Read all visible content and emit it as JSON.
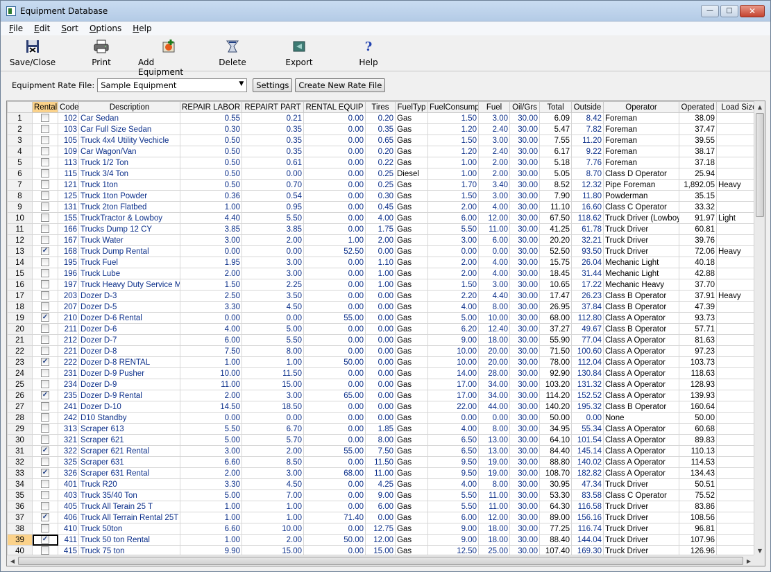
{
  "window": {
    "title": "Equipment Database"
  },
  "menu": [
    {
      "key": "F",
      "rest": "ile"
    },
    {
      "key": "E",
      "rest": "dit"
    },
    {
      "key": "S",
      "rest": "ort"
    },
    {
      "key": "O",
      "rest": "ptions"
    },
    {
      "key": "H",
      "rest": "elp"
    }
  ],
  "toolbar": {
    "save_close": "Save/Close",
    "print": "Print",
    "add_equipment": "Add Equipment",
    "delete": "Delete",
    "export": "Export",
    "help": "Help"
  },
  "rate_file": {
    "label": "Equipment Rate File:",
    "selected": "Sample Equipment",
    "settings_btn": "Settings",
    "create_btn": "Create New Rate File"
  },
  "columns": [
    "",
    "Rental",
    "Code",
    "Description",
    "REPAIR LABOR",
    "REPAIRT PART",
    "RENTAL EQUIP",
    "Tires",
    "FuelTyp",
    "FuelConsump",
    "Fuel",
    "Oil/Grs",
    "Total",
    "Outside",
    "Operator",
    "Operated",
    "Load Size"
  ],
  "rows": [
    {
      "n": "1",
      "rental": false,
      "code": "102",
      "desc": "Car Sedan",
      "rl": "0.55",
      "rp": "0.21",
      "re": "0.00",
      "tires": "0.20",
      "ft": "Gas",
      "fc": "1.50",
      "fuel": "3.00",
      "oil": "30.00",
      "total": "6.09",
      "outside": "8.42",
      "op": "Foreman",
      "operated": "38.09",
      "load": ""
    },
    {
      "n": "2",
      "rental": false,
      "code": "103",
      "desc": "Car Full Size Sedan",
      "rl": "0.30",
      "rp": "0.35",
      "re": "0.00",
      "tires": "0.35",
      "ft": "Gas",
      "fc": "1.20",
      "fuel": "2.40",
      "oil": "30.00",
      "total": "5.47",
      "outside": "7.82",
      "op": "Foreman",
      "operated": "37.47",
      "load": ""
    },
    {
      "n": "3",
      "rental": false,
      "code": "105",
      "desc": "Truck 4x4 Utility Vechicle",
      "rl": "0.50",
      "rp": "0.35",
      "re": "0.00",
      "tires": "0.65",
      "ft": "Gas",
      "fc": "1.50",
      "fuel": "3.00",
      "oil": "30.00",
      "total": "7.55",
      "outside": "11.20",
      "op": "Foreman",
      "operated": "39.55",
      "load": ""
    },
    {
      "n": "4",
      "rental": false,
      "code": "109",
      "desc": "Car Wagon/Van",
      "rl": "0.50",
      "rp": "0.35",
      "re": "0.00",
      "tires": "0.20",
      "ft": "Gas",
      "fc": "1.20",
      "fuel": "2.40",
      "oil": "30.00",
      "total": "6.17",
      "outside": "9.22",
      "op": "Foreman",
      "operated": "38.17",
      "load": ""
    },
    {
      "n": "5",
      "rental": false,
      "code": "113",
      "desc": "Truck 1/2 Ton",
      "rl": "0.50",
      "rp": "0.61",
      "re": "0.00",
      "tires": "0.22",
      "ft": "Gas",
      "fc": "1.00",
      "fuel": "2.00",
      "oil": "30.00",
      "total": "5.18",
      "outside": "7.76",
      "op": "Foreman",
      "operated": "37.18",
      "load": ""
    },
    {
      "n": "6",
      "rental": false,
      "code": "115",
      "desc": "Truck 3/4 Ton",
      "rl": "0.50",
      "rp": "0.00",
      "re": "0.00",
      "tires": "0.25",
      "ft": "Diesel",
      "fc": "1.00",
      "fuel": "2.00",
      "oil": "30.00",
      "total": "5.05",
      "outside": "8.70",
      "op": "Class D Operator",
      "operated": "25.94",
      "load": ""
    },
    {
      "n": "7",
      "rental": false,
      "code": "121",
      "desc": "Truck 1ton",
      "rl": "0.50",
      "rp": "0.70",
      "re": "0.00",
      "tires": "0.25",
      "ft": "Gas",
      "fc": "1.70",
      "fuel": "3.40",
      "oil": "30.00",
      "total": "8.52",
      "outside": "12.32",
      "op": "Pipe Foreman",
      "operated": "1,892.05",
      "load": "Heavy"
    },
    {
      "n": "8",
      "rental": false,
      "code": "125",
      "desc": "Truck 1ton Powder",
      "rl": "0.36",
      "rp": "0.54",
      "re": "0.00",
      "tires": "0.30",
      "ft": "Gas",
      "fc": "1.50",
      "fuel": "3.00",
      "oil": "30.00",
      "total": "7.90",
      "outside": "11.80",
      "op": "Powderman",
      "operated": "35.15",
      "load": ""
    },
    {
      "n": "9",
      "rental": false,
      "code": "131",
      "desc": "Truck 2ton Flatbed",
      "rl": "1.00",
      "rp": "0.95",
      "re": "0.00",
      "tires": "0.45",
      "ft": "Gas",
      "fc": "2.00",
      "fuel": "4.00",
      "oil": "30.00",
      "total": "11.10",
      "outside": "16.60",
      "op": "Class C Operator",
      "operated": "33.32",
      "load": ""
    },
    {
      "n": "10",
      "rental": false,
      "code": "155",
      "desc": "TruckTractor & Lowboy",
      "rl": "4.40",
      "rp": "5.50",
      "re": "0.00",
      "tires": "4.00",
      "ft": "Gas",
      "fc": "6.00",
      "fuel": "12.00",
      "oil": "30.00",
      "total": "67.50",
      "outside": "118.62",
      "op": "Truck Driver (Lowboy)",
      "operated": "91.97",
      "load": "Light"
    },
    {
      "n": "11",
      "rental": false,
      "code": "166",
      "desc": "Trucks Dump 12 CY",
      "rl": "3.85",
      "rp": "3.85",
      "re": "0.00",
      "tires": "1.75",
      "ft": "Gas",
      "fc": "5.50",
      "fuel": "11.00",
      "oil": "30.00",
      "total": "41.25",
      "outside": "61.78",
      "op": "Truck Driver",
      "operated": "60.81",
      "load": ""
    },
    {
      "n": "12",
      "rental": false,
      "code": "167",
      "desc": "Truck Water",
      "rl": "3.00",
      "rp": "2.00",
      "re": "1.00",
      "tires": "2.00",
      "ft": "Gas",
      "fc": "3.00",
      "fuel": "6.00",
      "oil": "30.00",
      "total": "20.20",
      "outside": "32.21",
      "op": "Truck Driver",
      "operated": "39.76",
      "load": ""
    },
    {
      "n": "13",
      "rental": true,
      "code": "168",
      "desc": "Truck Dump Rental",
      "rl": "0.00",
      "rp": "0.00",
      "re": "52.50",
      "tires": "0.00",
      "ft": "Gas",
      "fc": "0.00",
      "fuel": "0.00",
      "oil": "30.00",
      "total": "52.50",
      "outside": "93.50",
      "op": "Truck Driver",
      "operated": "72.06",
      "load": "Heavy"
    },
    {
      "n": "14",
      "rental": false,
      "code": "195",
      "desc": "Truck Fuel",
      "rl": "1.95",
      "rp": "3.00",
      "re": "0.00",
      "tires": "1.10",
      "ft": "Gas",
      "fc": "2.00",
      "fuel": "4.00",
      "oil": "30.00",
      "total": "15.75",
      "outside": "26.04",
      "op": "Mechanic Light",
      "operated": "40.18",
      "load": ""
    },
    {
      "n": "15",
      "rental": false,
      "code": "196",
      "desc": "Truck Lube",
      "rl": "2.00",
      "rp": "3.00",
      "re": "0.00",
      "tires": "1.00",
      "ft": "Gas",
      "fc": "2.00",
      "fuel": "4.00",
      "oil": "30.00",
      "total": "18.45",
      "outside": "31.44",
      "op": "Mechanic Light",
      "operated": "42.88",
      "load": ""
    },
    {
      "n": "16",
      "rental": false,
      "code": "197",
      "desc": "Truck Heavy Duty Service Me",
      "rl": "1.50",
      "rp": "2.25",
      "re": "0.00",
      "tires": "1.00",
      "ft": "Gas",
      "fc": "1.50",
      "fuel": "3.00",
      "oil": "30.00",
      "total": "10.65",
      "outside": "17.22",
      "op": "Mechanic Heavy",
      "operated": "37.70",
      "load": ""
    },
    {
      "n": "17",
      "rental": false,
      "code": "203",
      "desc": "Dozer D-3",
      "rl": "2.50",
      "rp": "3.50",
      "re": "0.00",
      "tires": "0.00",
      "ft": "Gas",
      "fc": "2.20",
      "fuel": "4.40",
      "oil": "30.00",
      "total": "17.47",
      "outside": "26.23",
      "op": "Class B Operator",
      "operated": "37.91",
      "load": "Heavy"
    },
    {
      "n": "18",
      "rental": false,
      "code": "207",
      "desc": "Dozer D-5",
      "rl": "3.30",
      "rp": "4.50",
      "re": "0.00",
      "tires": "0.00",
      "ft": "Gas",
      "fc": "4.00",
      "fuel": "8.00",
      "oil": "30.00",
      "total": "26.95",
      "outside": "37.84",
      "op": "Class B Operator",
      "operated": "47.39",
      "load": ""
    },
    {
      "n": "19",
      "rental": true,
      "code": "210",
      "desc": "Dozer D-6 Rental",
      "rl": "0.00",
      "rp": "0.00",
      "re": "55.00",
      "tires": "0.00",
      "ft": "Gas",
      "fc": "5.00",
      "fuel": "10.00",
      "oil": "30.00",
      "total": "68.00",
      "outside": "112.80",
      "op": "Class A Operator",
      "operated": "93.73",
      "load": ""
    },
    {
      "n": "20",
      "rental": false,
      "code": "211",
      "desc": "Dozer D-6",
      "rl": "4.00",
      "rp": "5.00",
      "re": "0.00",
      "tires": "0.00",
      "ft": "Gas",
      "fc": "6.20",
      "fuel": "12.40",
      "oil": "30.00",
      "total": "37.27",
      "outside": "49.67",
      "op": "Class B Operator",
      "operated": "57.71",
      "load": ""
    },
    {
      "n": "21",
      "rental": false,
      "code": "212",
      "desc": "Dozer D-7",
      "rl": "6.00",
      "rp": "5.50",
      "re": "0.00",
      "tires": "0.00",
      "ft": "Gas",
      "fc": "9.00",
      "fuel": "18.00",
      "oil": "30.00",
      "total": "55.90",
      "outside": "77.04",
      "op": "Class A Operator",
      "operated": "81.63",
      "load": ""
    },
    {
      "n": "22",
      "rental": false,
      "code": "221",
      "desc": "Dozer D-8",
      "rl": "7.50",
      "rp": "8.00",
      "re": "0.00",
      "tires": "0.00",
      "ft": "Gas",
      "fc": "10.00",
      "fuel": "20.00",
      "oil": "30.00",
      "total": "71.50",
      "outside": "100.60",
      "op": "Class A Operator",
      "operated": "97.23",
      "load": ""
    },
    {
      "n": "23",
      "rental": true,
      "code": "222",
      "desc": "Dozer D-8 RENTAL",
      "rl": "1.00",
      "rp": "1.00",
      "re": "50.00",
      "tires": "0.00",
      "ft": "Gas",
      "fc": "10.00",
      "fuel": "20.00",
      "oil": "30.00",
      "total": "78.00",
      "outside": "112.04",
      "op": "Class A Operator",
      "operated": "103.73",
      "load": ""
    },
    {
      "n": "24",
      "rental": false,
      "code": "231",
      "desc": "Dozer D-9 Pusher",
      "rl": "10.00",
      "rp": "11.50",
      "re": "0.00",
      "tires": "0.00",
      "ft": "Gas",
      "fc": "14.00",
      "fuel": "28.00",
      "oil": "30.00",
      "total": "92.90",
      "outside": "130.84",
      "op": "Class A Operator",
      "operated": "118.63",
      "load": ""
    },
    {
      "n": "25",
      "rental": false,
      "code": "234",
      "desc": "Dozer D-9",
      "rl": "11.00",
      "rp": "15.00",
      "re": "0.00",
      "tires": "0.00",
      "ft": "Gas",
      "fc": "17.00",
      "fuel": "34.00",
      "oil": "30.00",
      "total": "103.20",
      "outside": "131.32",
      "op": "Class A Operator",
      "operated": "128.93",
      "load": ""
    },
    {
      "n": "26",
      "rental": true,
      "code": "235",
      "desc": "Dozer D-9 Rental",
      "rl": "2.00",
      "rp": "3.00",
      "re": "65.00",
      "tires": "0.00",
      "ft": "Gas",
      "fc": "17.00",
      "fuel": "34.00",
      "oil": "30.00",
      "total": "114.20",
      "outside": "152.52",
      "op": "Class A Operator",
      "operated": "139.93",
      "load": ""
    },
    {
      "n": "27",
      "rental": false,
      "code": "241",
      "desc": "Dozer D-10",
      "rl": "14.50",
      "rp": "18.50",
      "re": "0.00",
      "tires": "0.00",
      "ft": "Gas",
      "fc": "22.00",
      "fuel": "44.00",
      "oil": "30.00",
      "total": "140.20",
      "outside": "195.32",
      "op": "Class B Operator",
      "operated": "160.64",
      "load": ""
    },
    {
      "n": "28",
      "rental": false,
      "code": "242",
      "desc": "D10 Standby",
      "rl": "0.00",
      "rp": "0.00",
      "re": "0.00",
      "tires": "0.00",
      "ft": "Gas",
      "fc": "0.00",
      "fuel": "0.00",
      "oil": "30.00",
      "total": "50.00",
      "outside": "0.00",
      "op": "None",
      "operated": "50.00",
      "load": ""
    },
    {
      "n": "29",
      "rental": false,
      "code": "313",
      "desc": "Scraper 613",
      "rl": "5.50",
      "rp": "6.70",
      "re": "0.00",
      "tires": "1.85",
      "ft": "Gas",
      "fc": "4.00",
      "fuel": "8.00",
      "oil": "30.00",
      "total": "34.95",
      "outside": "55.34",
      "op": "Class A Operator",
      "operated": "60.68",
      "load": ""
    },
    {
      "n": "30",
      "rental": false,
      "code": "321",
      "desc": "Scraper 621",
      "rl": "5.00",
      "rp": "5.70",
      "re": "0.00",
      "tires": "8.00",
      "ft": "Gas",
      "fc": "6.50",
      "fuel": "13.00",
      "oil": "30.00",
      "total": "64.10",
      "outside": "101.54",
      "op": "Class A Operator",
      "operated": "89.83",
      "load": ""
    },
    {
      "n": "31",
      "rental": true,
      "code": "322",
      "desc": "Scraper 621 Rental",
      "rl": "3.00",
      "rp": "2.00",
      "re": "55.00",
      "tires": "7.50",
      "ft": "Gas",
      "fc": "6.50",
      "fuel": "13.00",
      "oil": "30.00",
      "total": "84.40",
      "outside": "145.14",
      "op": "Class A Operator",
      "operated": "110.13",
      "load": ""
    },
    {
      "n": "32",
      "rental": false,
      "code": "325",
      "desc": "Scraper 631",
      "rl": "6.60",
      "rp": "8.50",
      "re": "0.00",
      "tires": "11.50",
      "ft": "Gas",
      "fc": "9.50",
      "fuel": "19.00",
      "oil": "30.00",
      "total": "88.80",
      "outside": "140.02",
      "op": "Class A Operator",
      "operated": "114.53",
      "load": ""
    },
    {
      "n": "33",
      "rental": true,
      "code": "326",
      "desc": "Scraper 631 Rental",
      "rl": "2.00",
      "rp": "3.00",
      "re": "68.00",
      "tires": "11.00",
      "ft": "Gas",
      "fc": "9.50",
      "fuel": "19.00",
      "oil": "30.00",
      "total": "108.70",
      "outside": "182.82",
      "op": "Class A Operator",
      "operated": "134.43",
      "load": ""
    },
    {
      "n": "34",
      "rental": false,
      "code": "401",
      "desc": "Truck R20",
      "rl": "3.30",
      "rp": "4.50",
      "re": "0.00",
      "tires": "4.25",
      "ft": "Gas",
      "fc": "4.00",
      "fuel": "8.00",
      "oil": "30.00",
      "total": "30.95",
      "outside": "47.34",
      "op": "Truck Driver",
      "operated": "50.51",
      "load": ""
    },
    {
      "n": "35",
      "rental": false,
      "code": "403",
      "desc": "Truck 35/40 Ton",
      "rl": "5.00",
      "rp": "7.00",
      "re": "0.00",
      "tires": "9.00",
      "ft": "Gas",
      "fc": "5.50",
      "fuel": "11.00",
      "oil": "30.00",
      "total": "53.30",
      "outside": "83.58",
      "op": "Class C Operator",
      "operated": "75.52",
      "load": ""
    },
    {
      "n": "36",
      "rental": false,
      "code": "405",
      "desc": "Truck All Terain 25 T",
      "rl": "1.00",
      "rp": "1.00",
      "re": "0.00",
      "tires": "6.00",
      "ft": "Gas",
      "fc": "5.50",
      "fuel": "11.00",
      "oil": "30.00",
      "total": "64.30",
      "outside": "116.58",
      "op": "Truck Driver",
      "operated": "83.86",
      "load": ""
    },
    {
      "n": "37",
      "rental": true,
      "code": "406",
      "desc": "Truck  All Terrain Rental 25T",
      "rl": "1.00",
      "rp": "1.00",
      "re": "71.40",
      "tires": "0.00",
      "ft": "Gas",
      "fc": "6.00",
      "fuel": "12.00",
      "oil": "30.00",
      "total": "89.00",
      "outside": "156.16",
      "op": "Truck Driver",
      "operated": "108.56",
      "load": ""
    },
    {
      "n": "38",
      "rental": false,
      "code": "410",
      "desc": "Truck 50ton",
      "rl": "6.60",
      "rp": "10.00",
      "re": "0.00",
      "tires": "12.75",
      "ft": "Gas",
      "fc": "9.00",
      "fuel": "18.00",
      "oil": "30.00",
      "total": "77.25",
      "outside": "116.74",
      "op": "Truck Driver",
      "operated": "96.81",
      "load": ""
    },
    {
      "n": "39",
      "rental": true,
      "code": "411",
      "desc": "Truck 50 ton Rental",
      "rl": "1.00",
      "rp": "2.00",
      "re": "50.00",
      "tires": "12.00",
      "ft": "Gas",
      "fc": "9.00",
      "fuel": "18.00",
      "oil": "30.00",
      "total": "88.40",
      "outside": "144.04",
      "op": "Truck Driver",
      "operated": "107.96",
      "load": ""
    },
    {
      "n": "40",
      "rental": false,
      "code": "415",
      "desc": "Truck 75 ton",
      "rl": "9.90",
      "rp": "15.00",
      "re": "0.00",
      "tires": "15.00",
      "ft": "Gas",
      "fc": "12.50",
      "fuel": "25.00",
      "oil": "30.00",
      "total": "107.40",
      "outside": "169.30",
      "op": "Truck Driver",
      "operated": "126.96",
      "load": ""
    }
  ],
  "selected_row": "39",
  "colors": {
    "header_highlight": "#fbd28a",
    "link_text": "#0b2f8a"
  },
  "icons": [
    "save-close-icon",
    "printer-icon",
    "add-equipment-icon",
    "delete-icon",
    "export-icon",
    "help-icon"
  ]
}
